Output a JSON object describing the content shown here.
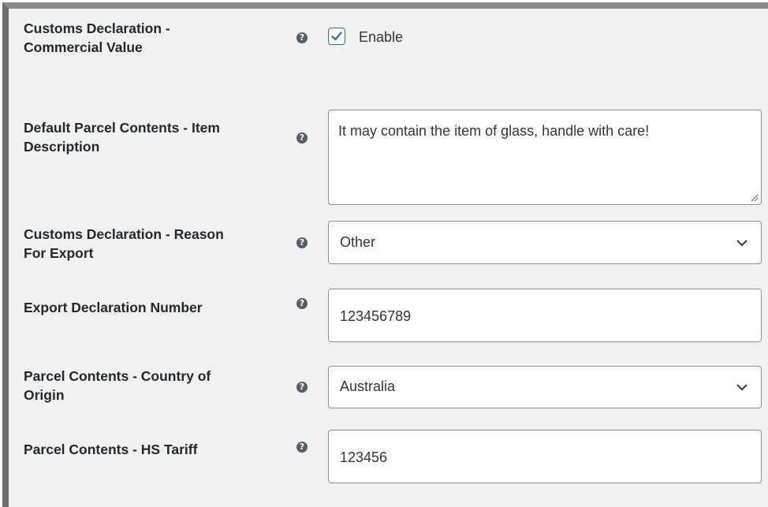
{
  "rows": [
    {
      "label_line1": "Customs Declaration -",
      "label_line2": "Commercial Value"
    },
    {
      "label_line1": "Default Parcel Contents - Item",
      "label_line2": "Description"
    },
    {
      "label_line1": "Customs Declaration - Reason",
      "label_line2": "For Export"
    },
    {
      "label_line1": "Export Declaration Number",
      "label_line2": ""
    },
    {
      "label_line1": "Parcel Contents - Country of",
      "label_line2": "Origin"
    },
    {
      "label_line1": "Parcel Contents - HS Tariff",
      "label_line2": ""
    }
  ],
  "help_glyph": "?",
  "commercial_value": {
    "checked": true,
    "label": "Enable"
  },
  "item_description": {
    "value": "It may contain the item of glass, handle with care!"
  },
  "reason_for_export": {
    "selected": "Other"
  },
  "export_declaration_number": {
    "value": "123456789"
  },
  "country_of_origin": {
    "selected": "Australia"
  },
  "hs_tariff": {
    "value": "123456"
  },
  "colors": {
    "accent": "#1e73be",
    "label_text": "#23282d",
    "panel_bg": "#f1f1f1",
    "field_border": "#8c8f94"
  },
  "icons": {
    "help": "question-circle-icon",
    "check": "checkmark-icon",
    "dropdown": "chevron-down-icon",
    "resize": "resize-handle-icon"
  }
}
